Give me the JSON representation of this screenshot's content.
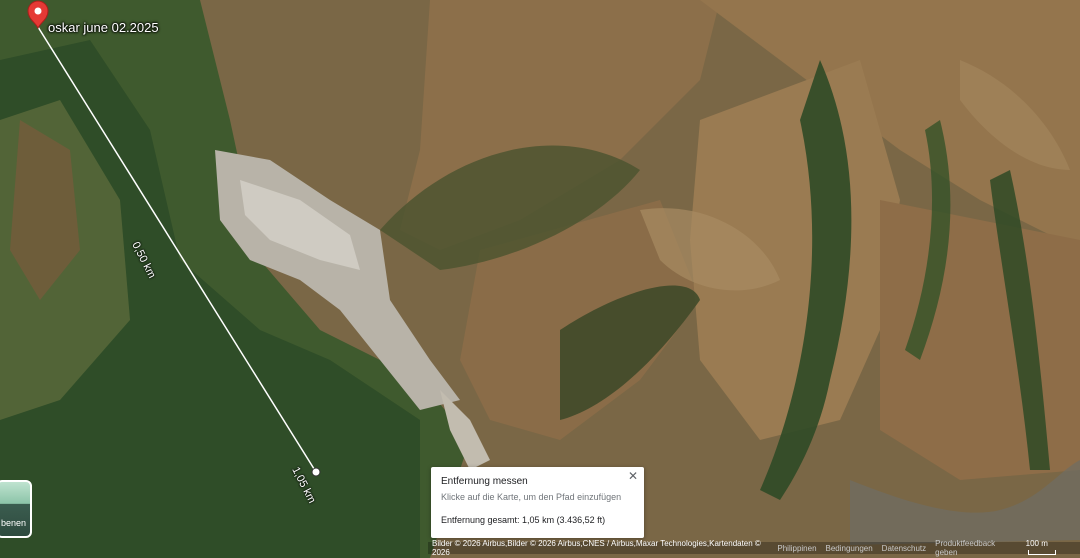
{
  "marker": {
    "label": "oskar june 02.2025",
    "icon": "map-pin-icon",
    "color": "#e53935"
  },
  "measure_line": {
    "color": "#ffffff",
    "mid_label": "0,50 km",
    "end_label": "1,05 km"
  },
  "measure_panel": {
    "title": "Entfernung messen",
    "hint": "Klicke auf die Karte, um den Pfad einzufügen",
    "total": "Entfernung gesamt: 1,05 km (3.436,52 ft)",
    "close_icon": "close-icon"
  },
  "layer_switcher": {
    "label": "benen"
  },
  "footer": {
    "attribution": "Bilder © 2026 Airbus,Bilder © 2026 Airbus,CNES / Airbus,Maxar Technologies,Kartendaten © 2026",
    "region": "Philippinen",
    "terms": "Bedingungen",
    "privacy": "Datenschutz",
    "feedback": "Produktfeedback geben",
    "scale": "100 m"
  }
}
